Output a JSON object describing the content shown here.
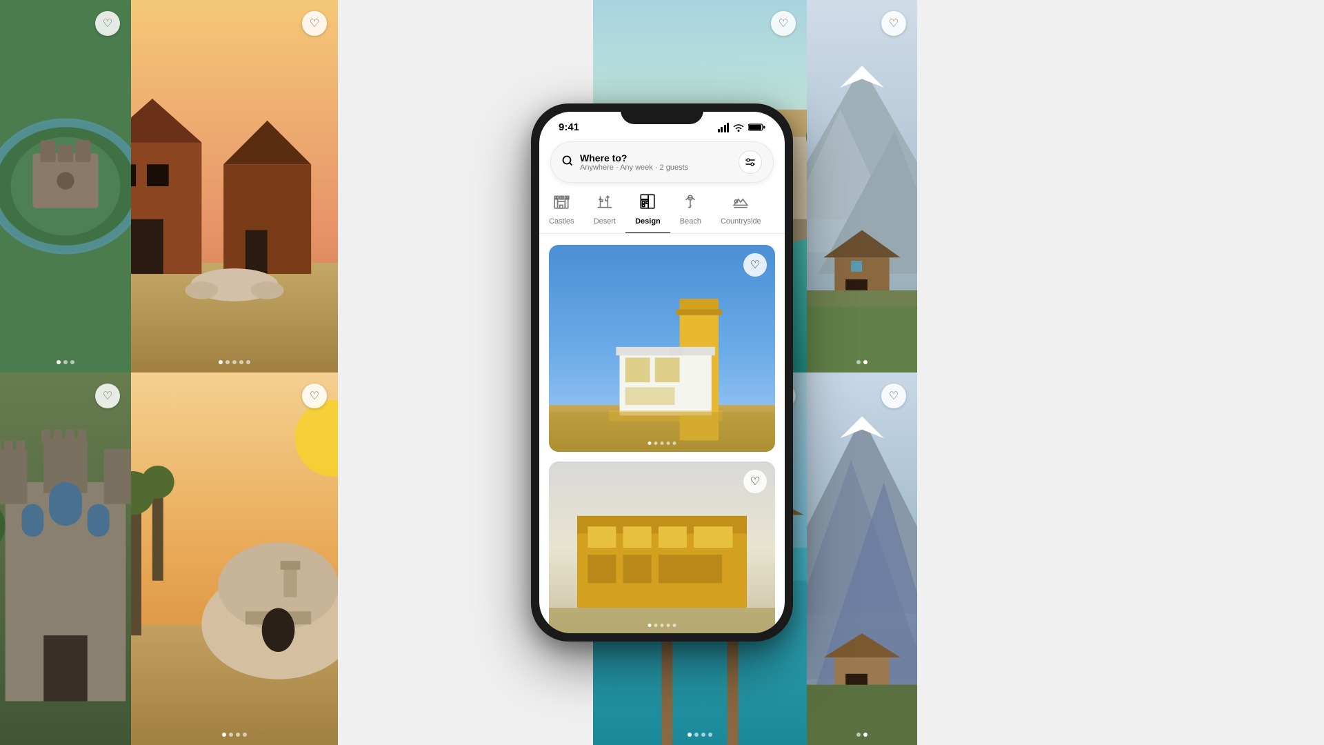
{
  "statusBar": {
    "time": "9:41"
  },
  "searchBar": {
    "placeholder": "Where to?",
    "subtext": "Anywhere · Any week · 2 guests"
  },
  "categories": [
    {
      "id": "castles",
      "label": "Castles",
      "icon": "castle",
      "active": false
    },
    {
      "id": "desert",
      "label": "Desert",
      "icon": "desert",
      "active": false
    },
    {
      "id": "design",
      "label": "Design",
      "icon": "design",
      "active": true
    },
    {
      "id": "beach",
      "label": "Beach",
      "icon": "beach",
      "active": false
    },
    {
      "id": "countryside",
      "label": "Countryside",
      "icon": "countryside",
      "active": false
    }
  ],
  "bgCards": [
    {
      "id": "castle-aerial",
      "colorClass": "card-castle-aerial",
      "dots": 3,
      "activeDot": 0
    },
    {
      "id": "modern-barn",
      "colorClass": "card-modern-barn",
      "dots": 5,
      "activeDot": 0
    },
    {
      "id": "coastal-villa",
      "colorClass": "card-coastal-villa",
      "dots": 5,
      "activeDot": 0
    },
    {
      "id": "mountain",
      "colorClass": "card-mountain",
      "dots": 2,
      "activeDot": 1
    },
    {
      "id": "castle2",
      "colorClass": "card-castle2",
      "dots": 3,
      "activeDot": 0
    },
    {
      "id": "desert",
      "colorClass": "card-desert",
      "dots": 4,
      "activeDot": 0
    },
    {
      "id": "overwater",
      "colorClass": "card-overwater",
      "dots": 4,
      "activeDot": 0
    },
    {
      "id": "mountain2",
      "colorClass": "card-mountain2",
      "dots": 2,
      "activeDot": 1
    }
  ],
  "phoneListings": [
    {
      "id": "design1",
      "colorClass": "card-yellow-modern",
      "dots": 5,
      "activeDot": 0
    },
    {
      "id": "design2",
      "colorClass": "card-yellow2",
      "dots": 5,
      "activeDot": 0
    }
  ],
  "icons": {
    "search": "🔍",
    "heart": "♡",
    "filter": "⇄"
  }
}
